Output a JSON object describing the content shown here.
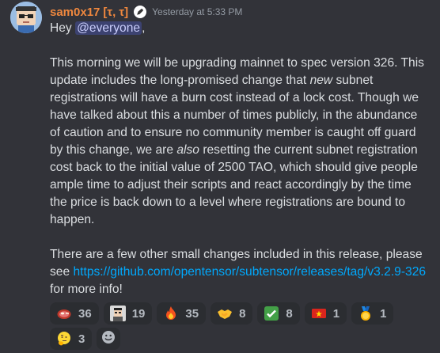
{
  "author": {
    "name": "sam0x17",
    "tag": "[τ, τ]",
    "role_icon": "role-badge-icon",
    "timestamp": "Yesterday at 5:33 PM"
  },
  "message": {
    "greeting": "Hey ",
    "mention": "@everyone",
    "greeting_end": ",",
    "p1_a": "This morning we will be upgrading mainnet to spec version 326. This update includes the long-promised change that ",
    "p1_em": "new",
    "p1_b": " subnet registrations will have a burn cost instead of a lock cost. Though we have talked about this a number of times publicly, in the abundance of caution and to ensure no community member is caught off guard by this change, we are ",
    "p1_em2": "also",
    "p1_c": " resetting the current subnet registration cost back to the initial value of 2500 TAO, which should give people ample time to adjust their scripts and react accordingly by the time the price is back down to a level where registrations are bound to happen.",
    "p2_a": "There are a few other small changes included in this release, please see ",
    "p2_link": "https://github.com/opentensor/subtensor/releases/tag/v3.2.9-326",
    "p2_b": " for more info!"
  },
  "reactions": [
    {
      "emoji": "steak-icon",
      "count": "36"
    },
    {
      "emoji": "portrait-icon",
      "count": "19"
    },
    {
      "emoji": "fire-icon",
      "count": "35"
    },
    {
      "emoji": "handshake-icon",
      "count": "8"
    },
    {
      "emoji": "check-mark-icon",
      "count": "8"
    },
    {
      "emoji": "vietnam-flag-icon",
      "count": "1"
    },
    {
      "emoji": "medal-icon",
      "count": "1"
    },
    {
      "emoji": "thinking-face-icon",
      "count": "3"
    }
  ],
  "colors": {
    "background": "#323339",
    "username": "#f0883e",
    "link": "#00a8fc",
    "mention_bg": "#3c4270",
    "reaction_bg": "#2b2d31"
  }
}
